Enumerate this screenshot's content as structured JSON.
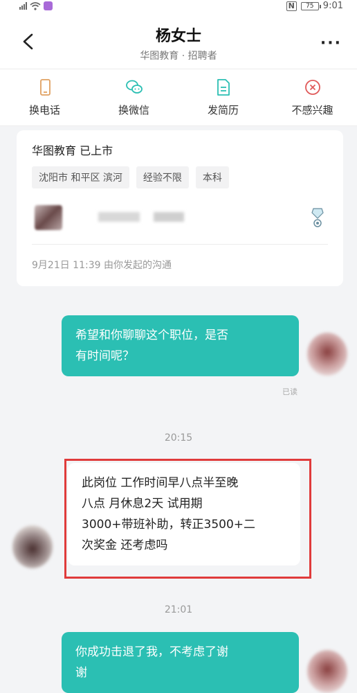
{
  "status_bar": {
    "time": "9:01",
    "battery": "75",
    "nfc": "N"
  },
  "header": {
    "title": "杨女士",
    "subtitle": "华图教育 · 招聘者"
  },
  "actions": [
    {
      "label": "换电话",
      "icon": "phone-icon",
      "color": "#e0a060"
    },
    {
      "label": "换微信",
      "icon": "wechat-icon",
      "color": "#2bbfb3"
    },
    {
      "label": "发简历",
      "icon": "resume-icon",
      "color": "#2bbfb3"
    },
    {
      "label": "不感兴趣",
      "icon": "not-interested-icon",
      "color": "#e05a5a"
    }
  ],
  "job_card": {
    "company": "华图教育 已上市",
    "tags": [
      "沈阳市 和平区 滨河",
      "经验不限",
      "本科"
    ],
    "meta": "9月21日 11:39 由你发起的沟通"
  },
  "messages": [
    {
      "from": "me",
      "text_lines": [
        "希望和你聊聊这个职位，是否",
        "有时间呢？"
      ],
      "status": "已读"
    },
    {
      "type": "time",
      "text": "20:15"
    },
    {
      "from": "recruiter",
      "text_lines": [
        "此岗位 工作时间早八点半至晚",
        "八点 月休息2天 试用期",
        "3000+带班补助，转正3500+二",
        "次奖金 还考虑吗"
      ]
    },
    {
      "type": "time",
      "text": "21:01"
    },
    {
      "from": "me",
      "text_lines": [
        "你成功击退了我，不考虑了谢",
        "谢"
      ]
    }
  ],
  "colors": {
    "accent": "#2bbfb3",
    "highlight": "#e03b3b"
  }
}
